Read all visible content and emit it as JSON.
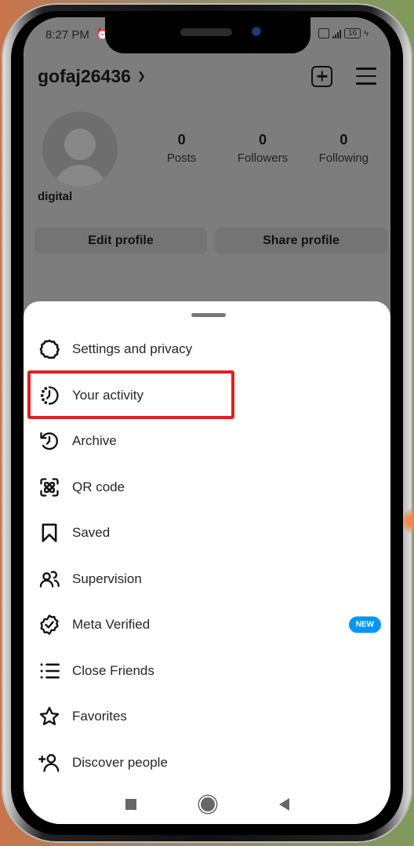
{
  "status_bar": {
    "time": "8:27 PM",
    "battery": "16"
  },
  "header": {
    "username": "gofaj26436",
    "chevron": "⌄"
  },
  "profile": {
    "display_name": "digital",
    "stats": [
      {
        "count": "0",
        "label": "Posts"
      },
      {
        "count": "0",
        "label": "Followers"
      },
      {
        "count": "0",
        "label": "Following"
      }
    ],
    "buttons": {
      "edit": "Edit profile",
      "share": "Share profile"
    }
  },
  "menu": {
    "items": [
      {
        "label": "Settings and privacy",
        "icon": "settings-icon"
      },
      {
        "label": "Your activity",
        "icon": "activity-icon",
        "highlighted": true
      },
      {
        "label": "Archive",
        "icon": "archive-icon"
      },
      {
        "label": "QR code",
        "icon": "qr-code-icon"
      },
      {
        "label": "Saved",
        "icon": "bookmark-icon"
      },
      {
        "label": "Supervision",
        "icon": "supervision-icon"
      },
      {
        "label": "Meta Verified",
        "icon": "verified-badge-icon",
        "badge": "NEW"
      },
      {
        "label": "Close Friends",
        "icon": "close-friends-icon"
      },
      {
        "label": "Favorites",
        "icon": "star-icon"
      },
      {
        "label": "Discover people",
        "icon": "add-person-icon"
      }
    ]
  },
  "colors": {
    "highlight": "#e02020",
    "badge": "#0095f6"
  }
}
